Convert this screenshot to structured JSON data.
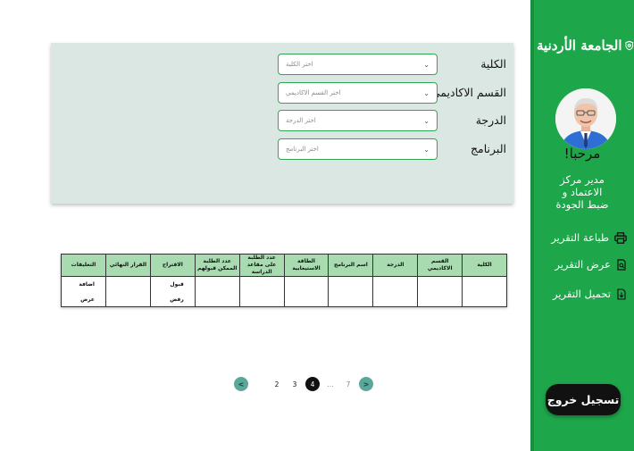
{
  "sidebar": {
    "logo_text": "الجامعة الأردنية",
    "welcome": "مرحبا!",
    "role_lines": [
      "مدير مركز",
      "الاعتماد و",
      "ضبط الجودة"
    ],
    "menu": [
      {
        "label": "طباعة التقرير",
        "icon": "printer-icon"
      },
      {
        "label": "عرض التقرير",
        "icon": "view-report-icon"
      },
      {
        "label": "تحميل التقرير",
        "icon": "download-report-icon"
      }
    ],
    "logout_label": "تسجيل خروج"
  },
  "filters": [
    {
      "label": "الكلية",
      "placeholder": "اختر الكلية"
    },
    {
      "label": "القسم الاكاديمي",
      "placeholder": "اختر القسم الاكاديمي"
    },
    {
      "label": "الدرجة",
      "placeholder": "اختر الدرجة"
    },
    {
      "label": "البرنامج",
      "placeholder": "اختر البرنامج"
    }
  ],
  "table": {
    "headers": [
      "الكلية",
      "القسم الاكاديمي",
      "الدرجة",
      "اسم البرنامج",
      "الطاقة الاستيعابية",
      "عدد الطلبة على مقاعد الدراسة",
      "عدد الطلبة الممكن قبولهم",
      "الاقتراح",
      "القرار النهائي",
      "التعليقات"
    ],
    "row": {
      "suggestion_options": [
        "قبول",
        "رفض"
      ],
      "comment_actions": [
        "اضافة",
        "عرض"
      ]
    }
  },
  "pagination": {
    "prev": "<",
    "next": ">",
    "pages": [
      "7",
      "...",
      "4",
      "3",
      "2"
    ],
    "active": "4"
  },
  "colors": {
    "sidebar": "#1ea64a",
    "panel": "#dbe7e2",
    "table_header": "#a8dbb0",
    "pager_arrow": "#5aa89a"
  }
}
